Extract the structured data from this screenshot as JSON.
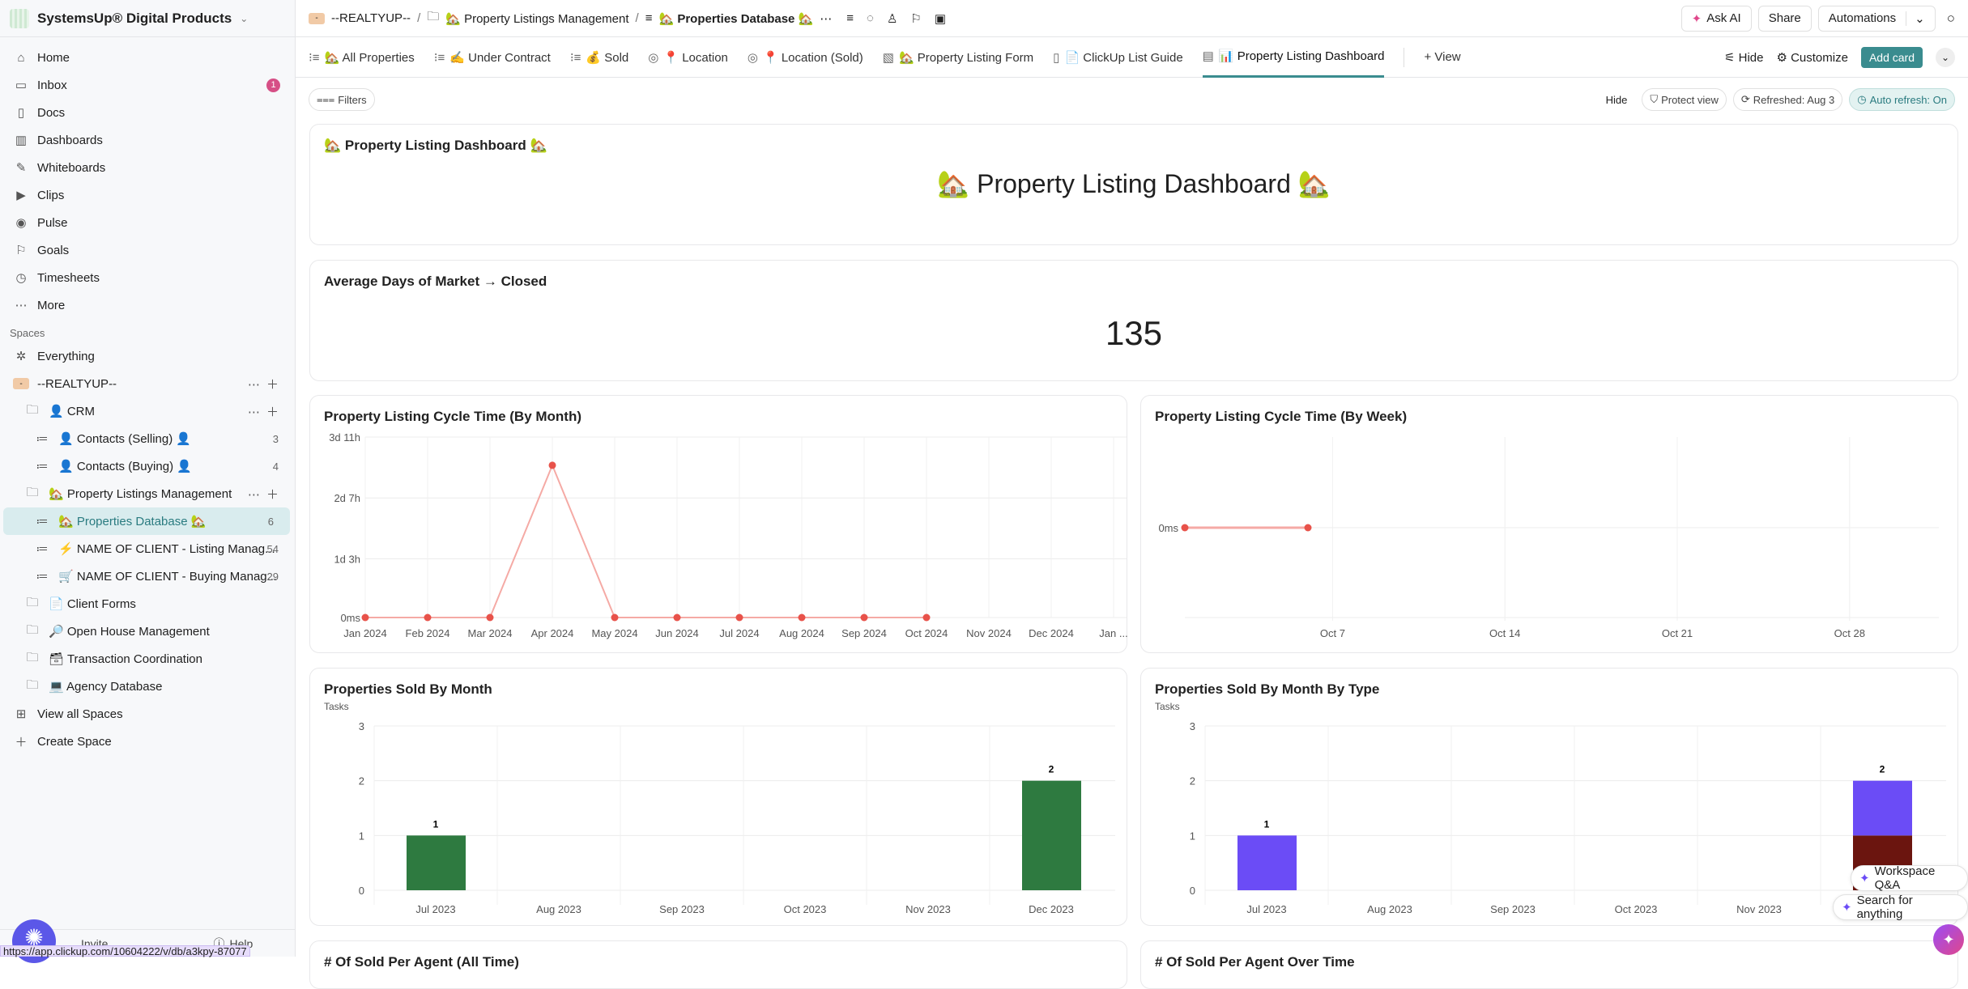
{
  "workspace": {
    "name": "SystemsUp® Digital Products"
  },
  "sidebar": {
    "nav": [
      {
        "label": "Home",
        "icon": "home-icon",
        "glyph": "⌂"
      },
      {
        "label": "Inbox",
        "icon": "inbox-icon",
        "glyph": "▭",
        "badge": "1"
      },
      {
        "label": "Docs",
        "icon": "docs-icon",
        "glyph": "▯"
      },
      {
        "label": "Dashboards",
        "icon": "dashboards-icon",
        "glyph": "▥"
      },
      {
        "label": "Whiteboards",
        "icon": "whiteboards-icon",
        "glyph": "✎"
      },
      {
        "label": "Clips",
        "icon": "clips-icon",
        "glyph": "▶"
      },
      {
        "label": "Pulse",
        "icon": "pulse-icon",
        "glyph": "◉"
      },
      {
        "label": "Goals",
        "icon": "goals-icon",
        "glyph": "⚐"
      },
      {
        "label": "Timesheets",
        "icon": "timesheets-icon",
        "glyph": "◷"
      },
      {
        "label": "More",
        "icon": "more-icon",
        "glyph": "⋯"
      }
    ],
    "spaces_label": "Spaces",
    "everything": "Everything",
    "space": {
      "label": "--REALTYUP--",
      "avatar": "-"
    },
    "tree": [
      {
        "label": "👤 CRM",
        "type": "folder",
        "level": 1,
        "actions": true
      },
      {
        "label": "👤 Contacts (Selling) 👤",
        "type": "list",
        "level": 2,
        "count": "3"
      },
      {
        "label": "👤 Contacts (Buying) 👤",
        "type": "list",
        "level": 2,
        "count": "4"
      },
      {
        "label": "🏡 Property Listings Management",
        "type": "folder",
        "level": 1,
        "actions": true
      },
      {
        "label": "🏡 Properties Database 🏡",
        "type": "list",
        "level": 2,
        "count": "6",
        "active": true
      },
      {
        "label": "⚡ NAME OF CLIENT - Listing Manag...",
        "type": "list",
        "level": 2,
        "count": "54"
      },
      {
        "label": "🛒 NAME OF CLIENT - Buying Manag...",
        "type": "list",
        "level": 2,
        "count": "29"
      },
      {
        "label": "📄 Client Forms",
        "type": "folder",
        "level": 1
      },
      {
        "label": "🔎 Open House Management",
        "type": "folder",
        "level": 1
      },
      {
        "label": "🗃 Transaction Coordination",
        "type": "folder",
        "level": 1
      },
      {
        "label": "💻 Agency Database",
        "type": "folder",
        "level": 1
      }
    ],
    "view_all": "View all Spaces",
    "create": "Create Space",
    "invite": "Invite",
    "help": "Help"
  },
  "breadcrumb": [
    "--REALTYUP--",
    "🏡 Property Listings Management",
    "🏡 Properties Database 🏡"
  ],
  "topbar": {
    "ask_ai": "Ask AI",
    "share": "Share",
    "automations": "Automations"
  },
  "tabs": [
    {
      "label": "🏡 All Properties"
    },
    {
      "label": "✍ Under Contract"
    },
    {
      "label": "💰 Sold"
    },
    {
      "label": "📍 Location"
    },
    {
      "label": "📍 Location (Sold)"
    },
    {
      "label": "🏡 Property Listing Form"
    },
    {
      "label": "📄 ClickUp List Guide"
    },
    {
      "label": "📊 Property Listing Dashboard",
      "selected": true
    }
  ],
  "tabs_right": {
    "add_view": "+ View",
    "hide": "Hide",
    "customize": "Customize",
    "add_card": "Add card"
  },
  "filters": {
    "filters": "Filters",
    "hide": "Hide",
    "protect": "Protect view",
    "refreshed": "Refreshed: Aug 3",
    "auto": "Auto refresh: On"
  },
  "cards": {
    "header": {
      "title": "🏡 Property Listing Dashboard 🏡",
      "body": "🏡 Property Listing Dashboard 🏡"
    },
    "avg": {
      "title": "Average Days of Market → Closed",
      "value": "135"
    },
    "bottom_left": "# Of Sold Per Agent (All Time)",
    "bottom_right": "# Of Sold Per Agent Over Time"
  },
  "chart_data": [
    {
      "type": "line",
      "title": "Property Listing Cycle Time (By Month)",
      "categories": [
        "Jan 2024",
        "Feb 2024",
        "Mar 2024",
        "Apr 2024",
        "May 2024",
        "Jun 2024",
        "Jul 2024",
        "Aug 2024",
        "Sep 2024",
        "Oct 2024",
        "Nov 2024",
        "Dec 2024",
        "Jan ..."
      ],
      "values_hours": [
        0,
        0,
        0,
        70,
        0,
        0,
        0,
        0,
        0,
        0,
        null,
        null,
        null
      ],
      "yticks": [
        "0ms",
        "1d 3h",
        "2d 7h",
        "3d 11h"
      ],
      "ytick_hours": [
        0,
        27,
        55,
        83
      ],
      "ylim_hours": [
        0,
        83
      ],
      "color": "#e8524a",
      "grid": true
    },
    {
      "type": "line",
      "title": "Property Listing Cycle Time (By Week)",
      "x": [
        "Oct 1",
        "Oct 6"
      ],
      "values_hours": [
        0,
        0
      ],
      "xticks": [
        "Oct 7",
        "Oct 14",
        "Oct 21",
        "Oct 28"
      ],
      "xrange": [
        "Oct 1",
        "Oct 31"
      ],
      "yticks": [
        "0ms"
      ],
      "color": "#e8524a",
      "grid": true
    },
    {
      "type": "bar",
      "title": "Properties Sold By Month",
      "ylabel": "Tasks",
      "categories": [
        "Jul 2023",
        "Aug 2023",
        "Sep 2023",
        "Oct 2023",
        "Nov 2023",
        "Dec 2023"
      ],
      "values": [
        1,
        0,
        0,
        0,
        0,
        2
      ],
      "ylim": [
        0,
        3
      ],
      "yticks": [
        "0",
        "1",
        "2",
        "3"
      ],
      "color": "#2e7a40",
      "grid": true
    },
    {
      "type": "bar",
      "stacked": true,
      "title": "Properties Sold By Month By Type",
      "ylabel": "Tasks",
      "categories": [
        "Jul 2023",
        "Aug 2023",
        "Sep 2023",
        "Oct 2023",
        "Nov 2023",
        "Dec 2023"
      ],
      "series": [
        {
          "values": [
            0,
            0,
            0,
            0,
            0,
            1
          ],
          "color": "#6b150f"
        },
        {
          "values": [
            1,
            0,
            0,
            0,
            0,
            1
          ],
          "color": "#6b4cf6"
        }
      ],
      "totals": [
        1,
        0,
        0,
        0,
        0,
        2
      ],
      "ylim": [
        0,
        3
      ],
      "yticks": [
        "0",
        "1",
        "2",
        "3"
      ],
      "grid": true
    }
  ],
  "floating": {
    "qa": "Workspace Q&A",
    "search": "Search for anything",
    "status_url": "https://app.clickup.com/10604222/v/db/a3kpy-87077"
  }
}
